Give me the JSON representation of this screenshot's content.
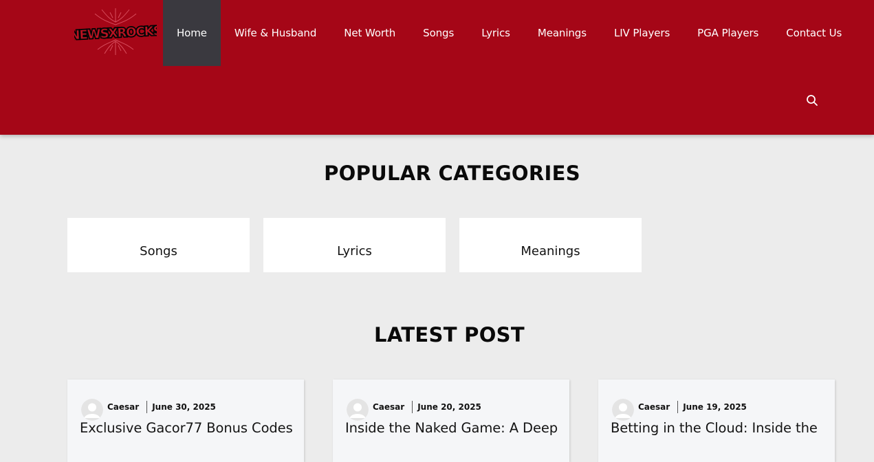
{
  "header": {
    "logo_text": "NEWSXROCKS",
    "nav": [
      {
        "label": "Home",
        "active": true
      },
      {
        "label": "Wife & Husband",
        "active": false
      },
      {
        "label": "Net Worth",
        "active": false
      },
      {
        "label": "Songs",
        "active": false
      },
      {
        "label": "Lyrics",
        "active": false
      },
      {
        "label": "Meanings",
        "active": false
      },
      {
        "label": "LIV Players",
        "active": false
      },
      {
        "label": "PGA Players",
        "active": false
      },
      {
        "label": "Contact Us",
        "active": false
      }
    ],
    "search_icon": "search-icon"
  },
  "popular": {
    "title": "POPULAR CATEGORIES",
    "categories": [
      "Songs",
      "Lyrics",
      "Meanings"
    ]
  },
  "latest": {
    "title": "LATEST POST",
    "posts": [
      {
        "author": "Caesar",
        "date": "June 30, 2025",
        "title": "Exclusive Gacor77 Bonus Codes"
      },
      {
        "author": "Caesar",
        "date": "June 20, 2025",
        "title": "Inside the Naked Game: A Deep"
      },
      {
        "author": "Caesar",
        "date": "June 19, 2025",
        "title": "Betting in the Cloud: Inside the"
      }
    ]
  },
  "colors": {
    "header_bg": "#a50617",
    "nav_active_bg": "#3a393f",
    "page_bg": "#ececec"
  }
}
